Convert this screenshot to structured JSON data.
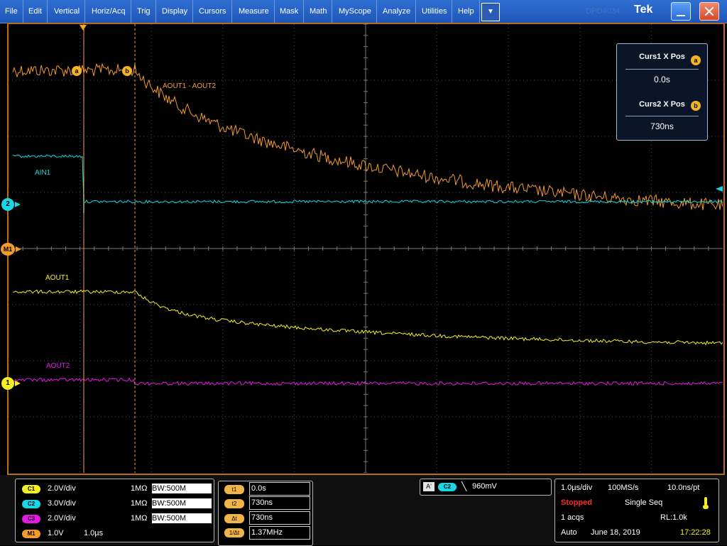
{
  "menu": {
    "items": [
      "File",
      "Edit",
      "Vertical",
      "Horiz/Acq",
      "Trig",
      "Display",
      "Cursors",
      "Measure",
      "Mask",
      "Math",
      "MyScope",
      "Analyze",
      "Utilities",
      "Help"
    ],
    "dropdown_glyph": "▼",
    "ghost_text": "DPO4034",
    "brand": "Tek"
  },
  "colors": {
    "ch1": "#f4ee22",
    "ch2": "#18d6e6",
    "ch3": "#e41ae4",
    "math": "#f39b2a",
    "cursor": "#f3a42a",
    "grid": "#4a4a4a"
  },
  "display": {
    "trace_labels": {
      "math": "AOUT1 - AOUT2",
      "ch2": "AIN1",
      "ch1": "AOUT1",
      "ch3": "AOUT2"
    },
    "cursor_a_glyph": "a",
    "cursor_b_glyph": "b",
    "markers": {
      "ch2": "2",
      "math": "M1",
      "ch1": "1"
    }
  },
  "cursor_readout": {
    "curs1_title": "Curs1 X Pos",
    "curs1_value": "0.0s",
    "curs2_title": "Curs2 X Pos",
    "curs2_value": "730ns"
  },
  "channels": [
    {
      "badge": "C1",
      "scale": "2.0V/div",
      "impedance": "1MΩ",
      "bw": "W:500M"
    },
    {
      "badge": "C2",
      "scale": "3.0V/div",
      "impedance": "1MΩ",
      "bw": "W:500M"
    },
    {
      "badge": "C3",
      "scale": "2.0V/div",
      "impedance": "1MΩ",
      "bw": "W:500M"
    },
    {
      "badge": "M1",
      "scale": "1.0V",
      "timebase": "1.0µs"
    }
  ],
  "bw_prefix": "B",
  "cursor_measure": [
    {
      "label": "t1",
      "value": "0.0s"
    },
    {
      "label": "t2",
      "value": "730ns"
    },
    {
      "label": "Δt",
      "value": "730ns"
    },
    {
      "label": "1/Δt",
      "value": "1.37MHz"
    }
  ],
  "trigger": {
    "source_badge": "A'",
    "channel_badge": "C2",
    "slope": "╲",
    "level": "960mV"
  },
  "acquisition": {
    "time_div": "1.0µs/div",
    "sample_rate": "100MS/s",
    "resolution": "10.0ns/pt",
    "state": "Stopped",
    "mode": "Single Seq",
    "acqs": "1 acqs",
    "record_length": "RL:1.0k",
    "trigger_mode": "Auto",
    "date": "June 18, 2019",
    "time": "17:22:28"
  }
}
